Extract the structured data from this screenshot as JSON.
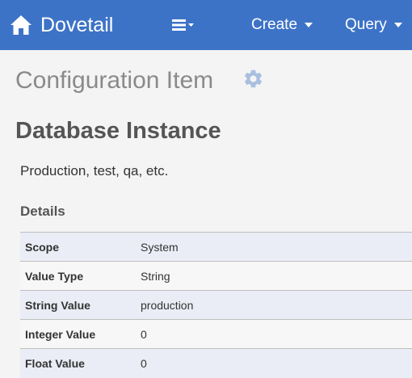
{
  "navbar": {
    "brand": "Dovetail",
    "menu_icon": "list-menu-icon",
    "items": [
      {
        "label": "Create"
      },
      {
        "label": "Query"
      }
    ]
  },
  "page": {
    "title": "Configuration Item",
    "settings_icon": "gear-icon"
  },
  "item": {
    "name": "Database Instance",
    "description": "Production, test, qa, etc."
  },
  "details": {
    "heading": "Details",
    "rows": [
      {
        "label": "Scope",
        "value": "System"
      },
      {
        "label": "Value Type",
        "value": "String"
      },
      {
        "label": "String Value",
        "value": "production"
      },
      {
        "label": "Integer Value",
        "value": "0"
      },
      {
        "label": "Float Value",
        "value": "0"
      }
    ]
  },
  "colors": {
    "navbar_bg": "#3d73c7",
    "page_bg": "#f4f4f4",
    "gear": "#a9bfe0"
  }
}
